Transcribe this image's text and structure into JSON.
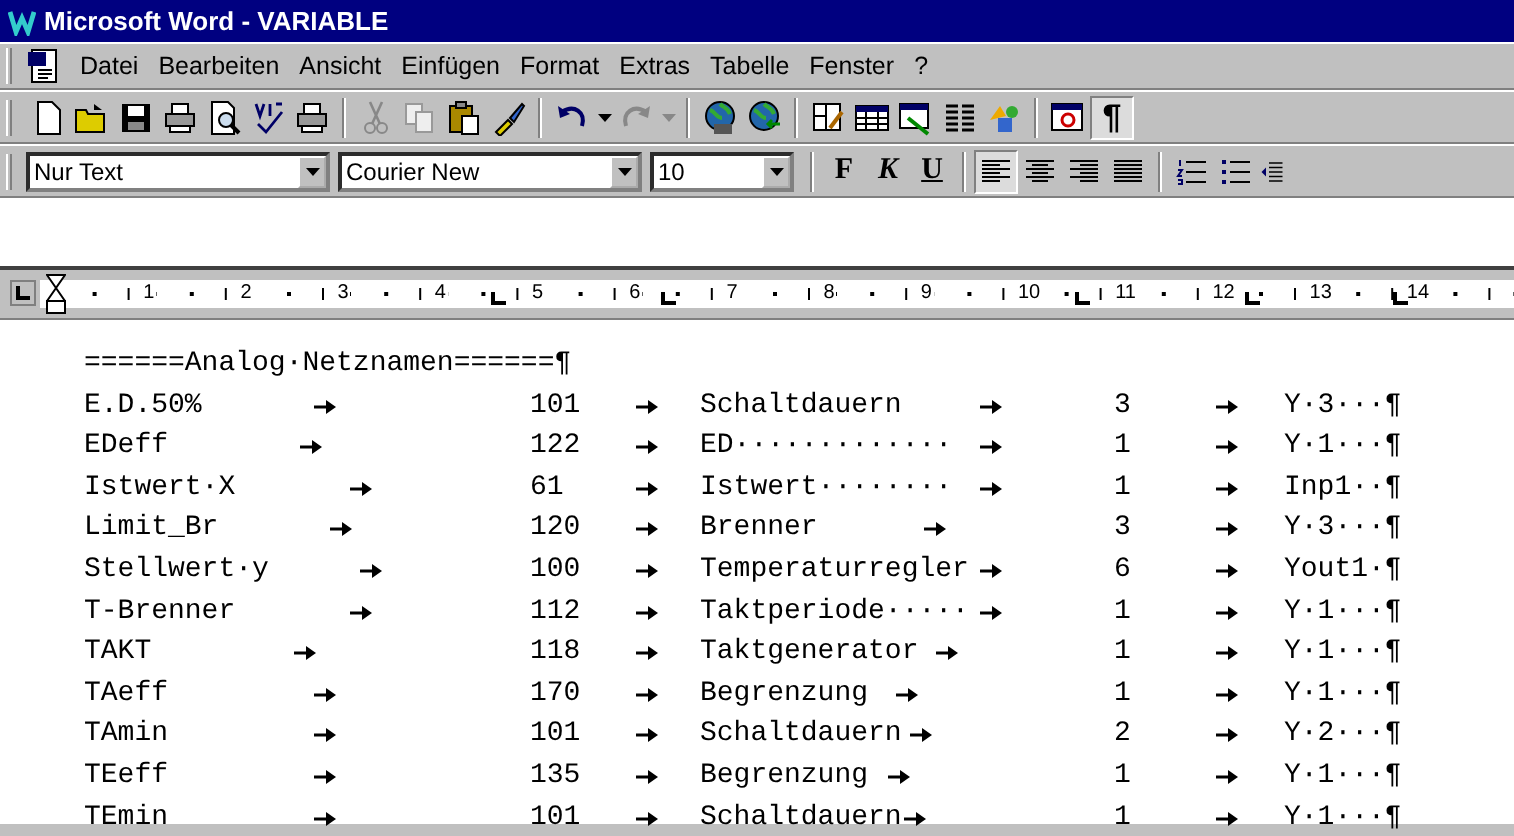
{
  "window": {
    "title": "Microsoft Word - VARIABLE"
  },
  "menu": [
    "Datei",
    "Bearbeiten",
    "Ansicht",
    "Einfügen",
    "Format",
    "Extras",
    "Tabelle",
    "Fenster",
    "?"
  ],
  "standard_toolbar": {
    "show_marks": {
      "label": "¶",
      "pressed": true
    }
  },
  "formatting": {
    "style": "Nur Text",
    "font": "Courier New",
    "size": "10",
    "bold": "F",
    "italic": "K",
    "underline": "U",
    "alignment": [
      {
        "kind": "left",
        "selected": true
      },
      {
        "kind": "center",
        "selected": false
      },
      {
        "kind": "right",
        "selected": false
      },
      {
        "kind": "justify",
        "selected": false
      }
    ]
  },
  "ruler": {
    "numbers": [
      "1",
      "2",
      "3",
      "4",
      "5",
      "6",
      "7",
      "8",
      "9",
      "10",
      "11",
      "12",
      "13",
      "14"
    ]
  },
  "document": {
    "heading": "======Analog·Netznamen======¶",
    "rows": [
      {
        "cells": [
          "E.D.50%",
          "101",
          "Schaltdauern",
          "3",
          "Y·3···¶"
        ]
      },
      {
        "cells": [
          "EDeff",
          "122",
          "ED·············",
          "1",
          "Y·1···¶"
        ]
      },
      {
        "cells": [
          "Istwert·X",
          "61",
          "Istwert········",
          "1",
          "Inp1··¶"
        ]
      },
      {
        "cells": [
          "Limit_Br",
          "120",
          "Brenner",
          "3",
          "Y·3···¶"
        ]
      },
      {
        "cells": [
          "Stellwert·y",
          "100",
          "Temperaturregler",
          "6",
          "Yout1·¶"
        ]
      },
      {
        "cells": [
          "T-Brenner",
          "112",
          "Taktperiode·····",
          "1",
          "Y·1···¶"
        ]
      },
      {
        "cells": [
          "TAKT",
          "118",
          "Taktgenerator",
          "1",
          "Y·1···¶"
        ]
      },
      {
        "cells": [
          "TAeff",
          "170",
          "Begrenzung",
          "1",
          "Y·1···¶"
        ]
      },
      {
        "cells": [
          "TAmin",
          "101",
          "Schaltdauern",
          "2",
          "Y·2···¶"
        ]
      },
      {
        "cells": [
          "TEeff",
          "135",
          "Begrenzung",
          "1",
          "Y·1···¶"
        ]
      },
      {
        "cells": [
          "TEmin",
          "101",
          "Schaltdauern",
          "1",
          "Y·1···¶"
        ]
      }
    ]
  }
}
